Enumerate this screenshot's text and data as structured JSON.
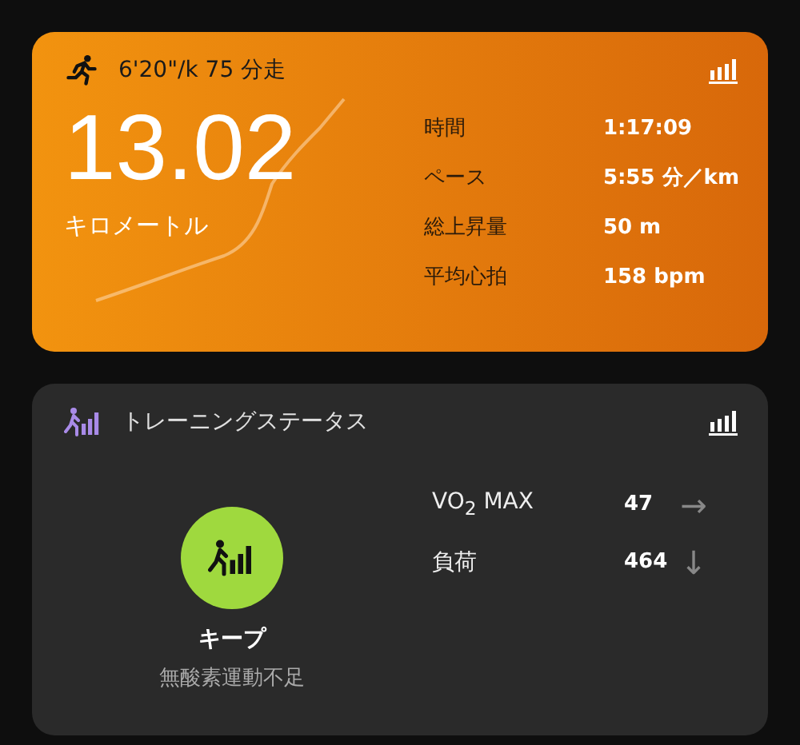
{
  "activity": {
    "title": "6'20\"/k 75 分走",
    "distance": "13.02",
    "unit": "キロメートル",
    "stats": [
      {
        "label": "時間",
        "value": "1:17:09"
      },
      {
        "label": "ペース",
        "value": "5:55 分／km"
      },
      {
        "label": "総上昇量",
        "value": "50 m"
      },
      {
        "label": "平均心拍",
        "value": "158 bpm"
      }
    ]
  },
  "training_status": {
    "title": "トレーニングステータス",
    "status": "キープ",
    "detail": "無酸素運動不足",
    "metrics": [
      {
        "label": "VO$_{2}$ MAX",
        "value": "47",
        "arrow": "→"
      },
      {
        "label": "負荷",
        "value": "464",
        "arrow": "↓"
      }
    ]
  }
}
